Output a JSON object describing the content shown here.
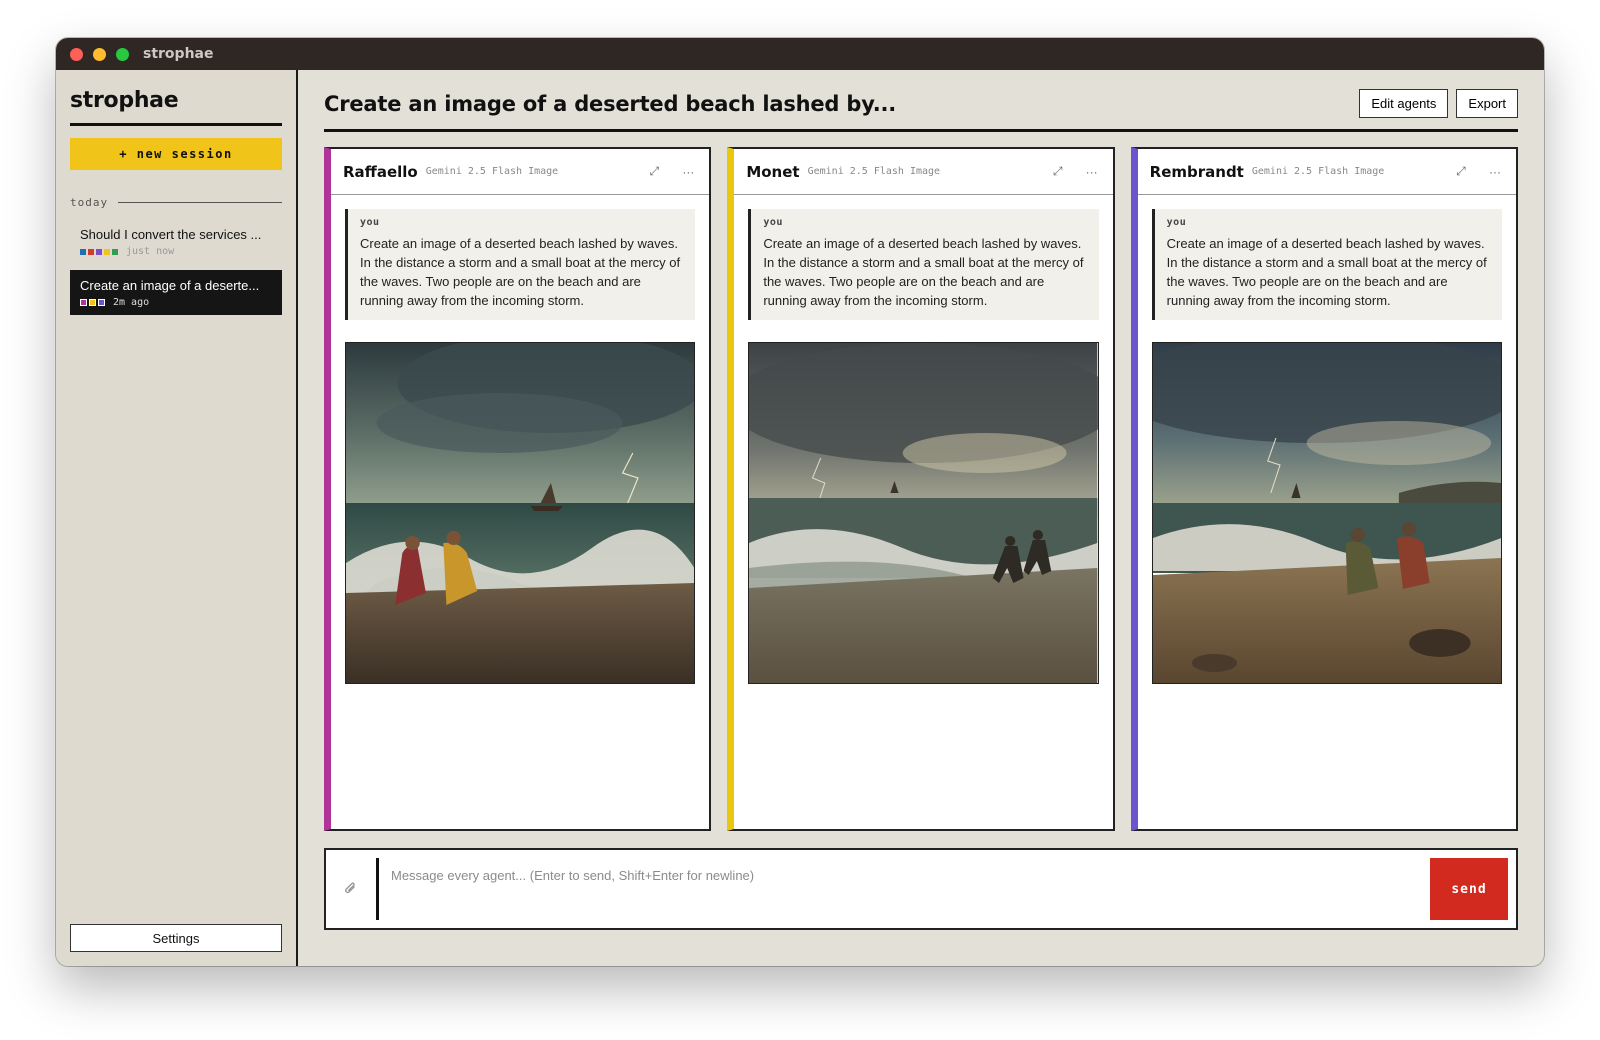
{
  "window": {
    "title": "strophae"
  },
  "sidebar": {
    "brand": "strophae",
    "new_session_label": "+ new session",
    "section_label": "today",
    "sessions": [
      {
        "title": "Should I convert the services ...",
        "time": "just now",
        "colors": [
          "#1f6fb2",
          "#d23b2a",
          "#7d4cc7",
          "#f0c419",
          "#2e9e4f"
        ]
      },
      {
        "title": "Create an image of a deserte...",
        "time": "2m ago",
        "colors": [
          "#b0339a",
          "#f0c419",
          "#6a55cf"
        ]
      }
    ],
    "settings_label": "Settings"
  },
  "header": {
    "title": "Create an image of a deserted beach lashed by...",
    "edit_agents_label": "Edit agents",
    "export_label": "Export"
  },
  "agents": [
    {
      "name": "Raffaello",
      "model": "Gemini 2.5 Flash Image",
      "accent": "#b0339a",
      "message_role": "you",
      "message_text": "Create an image of a deserted beach lashed by waves. In the distance a storm and a small boat at the mercy of the waves. Two people are on the beach and are running away from the incoming storm."
    },
    {
      "name": "Monet",
      "model": "Gemini 2.5 Flash Image",
      "accent": "#eac70f",
      "message_role": "you",
      "message_text": "Create an image of a deserted beach lashed by waves. In the distance a storm and a small boat at the mercy of the waves. Two people are on the beach and are running away from the incoming storm."
    },
    {
      "name": "Rembrandt",
      "model": "Gemini 2.5 Flash Image",
      "accent": "#6a55cf",
      "message_role": "you",
      "message_text": "Create an image of a deserted beach lashed by waves. In the distance a storm and a small boat at the mercy of the waves. Two people are on the beach and are running away from the incoming storm."
    }
  ],
  "icons": {
    "expand": "expand-icon",
    "more": "more-icon",
    "attach": "paperclip-icon"
  },
  "composer": {
    "placeholder": "Message every agent... (Enter to send, Shift+Enter for newline)",
    "send_label": "send"
  }
}
